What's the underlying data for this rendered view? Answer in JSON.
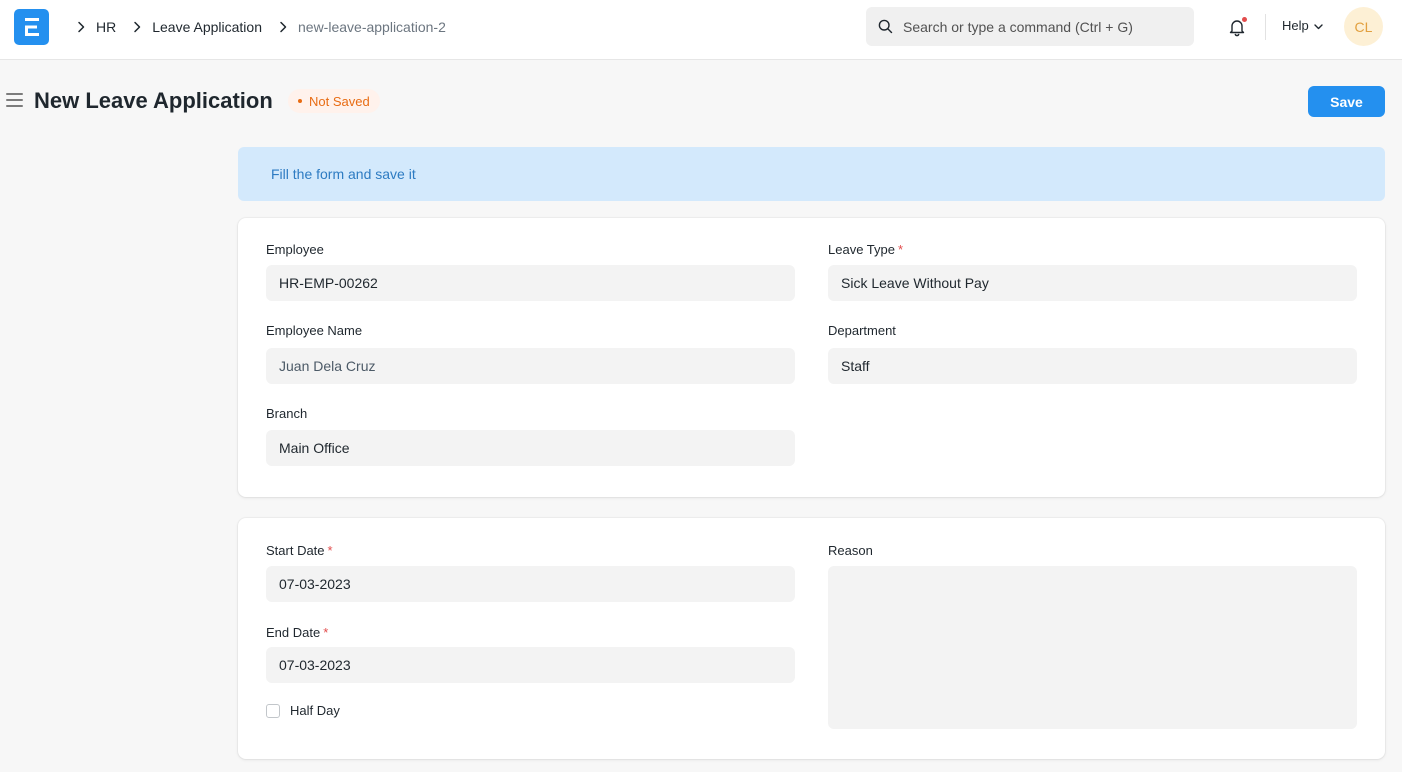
{
  "navbar": {
    "breadcrumbs": [
      "HR",
      "Leave Application",
      "new-leave-application-2"
    ],
    "search_placeholder": "Search or type a command (Ctrl + G)",
    "help_label": "Help",
    "avatar_initials": "CL"
  },
  "page": {
    "title": "New Leave Application",
    "status": "Not Saved",
    "save_label": "Save"
  },
  "alert": {
    "message": "Fill the form and save it"
  },
  "section1": {
    "employee": {
      "label": "Employee",
      "value": "HR-EMP-00262"
    },
    "leave_type": {
      "label": "Leave Type",
      "value": "Sick Leave Without Pay",
      "required_mark": "*"
    },
    "employee_name": {
      "label": "Employee Name",
      "value": "Juan Dela Cruz"
    },
    "department": {
      "label": "Department",
      "value": "Staff"
    },
    "branch": {
      "label": "Branch",
      "value": "Main Office"
    }
  },
  "section2": {
    "start_date": {
      "label": "Start Date",
      "value": "07-03-2023",
      "required_mark": "*"
    },
    "end_date": {
      "label": "End Date",
      "value": "07-03-2023",
      "required_mark": "*"
    },
    "half_day": {
      "label": "Half Day",
      "checked": false
    },
    "reason": {
      "label": "Reason",
      "value": ""
    }
  },
  "colors": {
    "primary": "#2490ef",
    "alert_bg": "#d3e9fc",
    "alert_text": "#2d7bc2",
    "status_text": "#e86c13",
    "required": "#e24c4c"
  },
  "icons": [
    "app-logo-icon",
    "chevron-right-icon",
    "search-icon",
    "bell-icon",
    "chevron-down-icon",
    "hamburger-icon"
  ]
}
